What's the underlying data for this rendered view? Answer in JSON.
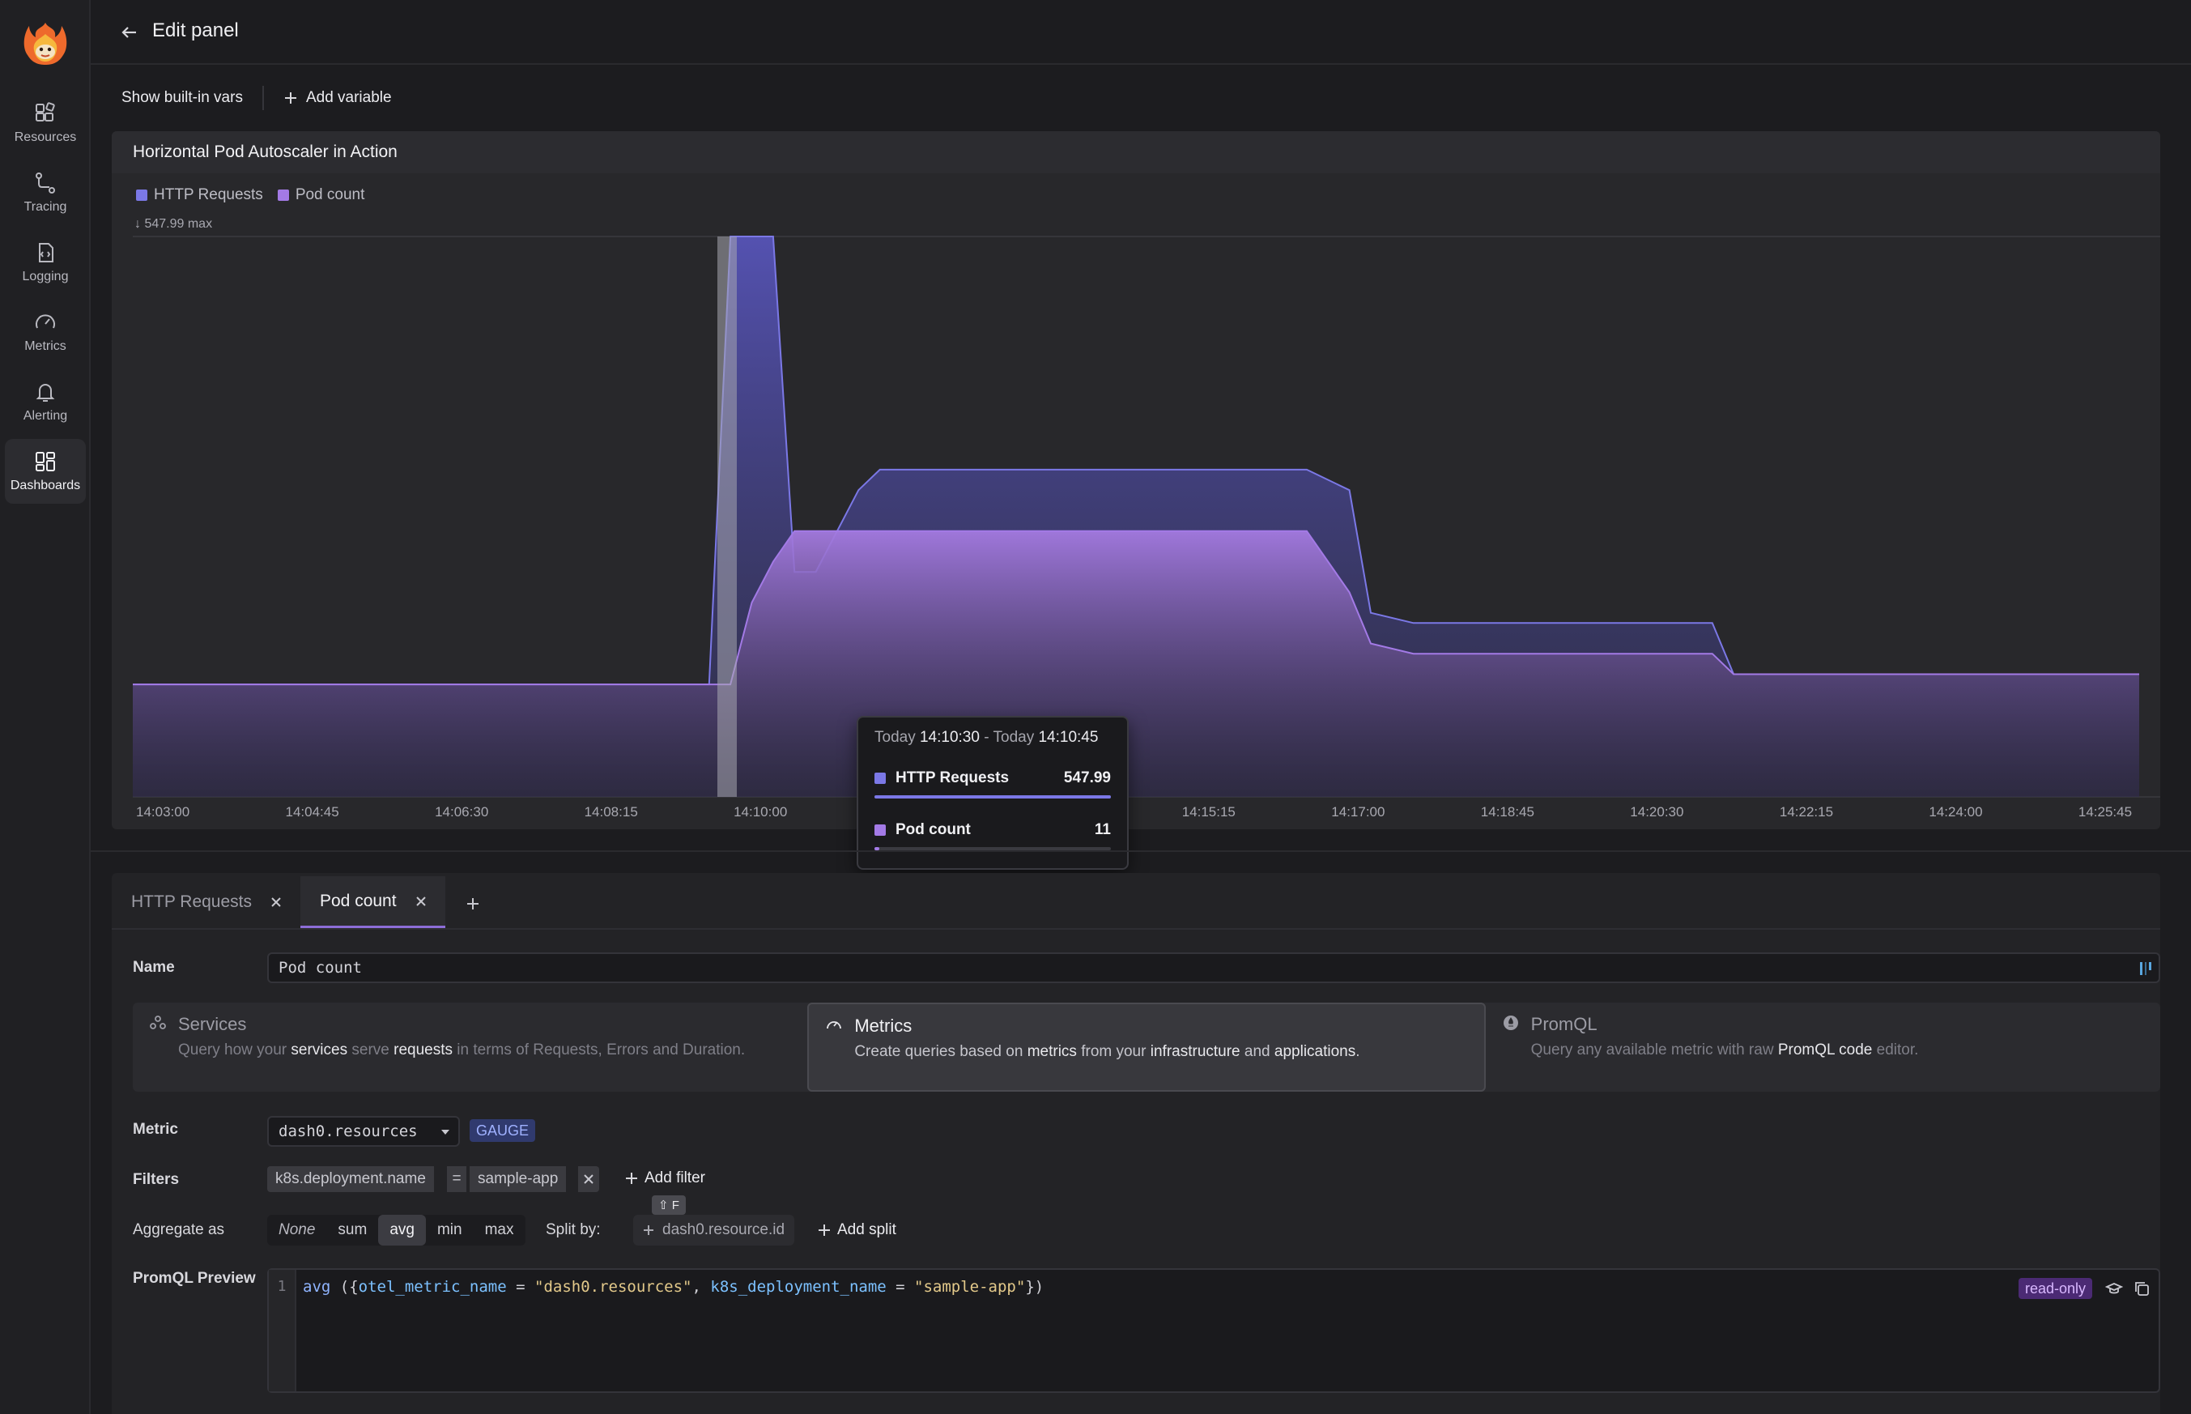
{
  "header": {
    "title": "Edit panel"
  },
  "sidebar": {
    "items": [
      {
        "label": "Resources",
        "icon": "resources-icon"
      },
      {
        "label": "Tracing",
        "icon": "tracing-icon"
      },
      {
        "label": "Logging",
        "icon": "logging-icon"
      },
      {
        "label": "Metrics",
        "icon": "metrics-icon"
      },
      {
        "label": "Alerting",
        "icon": "alerting-icon"
      },
      {
        "label": "Dashboards",
        "icon": "dashboards-icon",
        "active": true
      }
    ]
  },
  "toolbar": {
    "show_vars": "Show built-in vars",
    "add_variable": "Add variable"
  },
  "panel": {
    "title": "Horizontal Pod Autoscaler in Action",
    "ymax_label": "547.99 max"
  },
  "chart_data": {
    "type": "area",
    "title": "Horizontal Pod Autoscaler in Action",
    "x_ticks": [
      "14:03:00",
      "14:04:45",
      "14:06:30",
      "14:08:15",
      "14:10:00",
      "14:11:45",
      "14:13:30",
      "14:15:15",
      "14:17:00",
      "14:18:45",
      "14:20:30",
      "14:22:15",
      "14:24:00",
      "14:25:45"
    ],
    "x": [
      "14:03:00",
      "14:09:45",
      "14:10:00",
      "14:10:15",
      "14:10:30",
      "14:10:45",
      "14:11:00",
      "14:11:30",
      "14:11:45",
      "14:16:45",
      "14:17:15",
      "14:17:30",
      "14:18:00",
      "14:21:30",
      "14:21:45",
      "14:26:30"
    ],
    "ylim": [
      0,
      547.99
    ],
    "series": [
      {
        "name": "HTTP Requests",
        "color": "#7b78e6",
        "values": [
          110,
          110,
          547.99,
          547.99,
          547.99,
          220,
          220,
          300,
          320,
          320,
          300,
          180,
          170,
          170,
          120,
          120
        ]
      },
      {
        "name": "Pod count",
        "color": "#a37ae6",
        "values": [
          110,
          110,
          110,
          190,
          230,
          260,
          260,
          260,
          260,
          260,
          200,
          150,
          140,
          140,
          120,
          120
        ]
      }
    ],
    "legend": "top-left",
    "grid": false
  },
  "tooltip": {
    "from_prefix": "Today",
    "from_time": "14:10:30",
    "dash": "-",
    "to_prefix": "Today",
    "to_time": "14:10:45",
    "rows": [
      {
        "name": "HTTP Requests",
        "value": "547.99",
        "fraction": 1.0,
        "color": "#7b78e6"
      },
      {
        "name": "Pod count",
        "value": "11",
        "fraction": 0.02,
        "color": "#a37ae6"
      }
    ]
  },
  "editor": {
    "tabs": [
      {
        "label": "HTTP Requests",
        "active": false
      },
      {
        "label": "Pod count",
        "active": true
      }
    ],
    "name_label": "Name",
    "name_value": "Pod count",
    "query_types": [
      {
        "title": "Services",
        "desc": [
          "Query how your ",
          "services",
          " serve ",
          "requests",
          " in terms of Requests, Errors and Duration."
        ]
      },
      {
        "title": "Metrics",
        "desc": [
          "Create queries based on ",
          "metrics",
          " from your ",
          "infrastructure",
          " and ",
          "applications",
          "."
        ]
      },
      {
        "title": "PromQL",
        "desc": [
          "Query any available metric with raw ",
          "PromQL code",
          " editor."
        ]
      }
    ],
    "metric_label": "Metric",
    "metric_value": "dash0.resources",
    "metric_type": "GAUGE",
    "filters_label": "Filters",
    "filter": {
      "key": "k8s.deployment.name",
      "op": "=",
      "value": "sample-app"
    },
    "add_filter": "Add filter",
    "shortcut": "⇧ F",
    "aggregate_label": "Aggregate as",
    "aggregate_options": [
      "None",
      "sum",
      "avg",
      "min",
      "max"
    ],
    "aggregate_selected": "avg",
    "split_label": "Split by:",
    "split_placeholder": "dash0.resource.id",
    "add_split": "Add split",
    "preview_label": "PromQL Preview",
    "line_number": "1",
    "code": {
      "fn": "avg",
      "open": " ({",
      "k1": "otel_metric_name",
      "eq1": " = ",
      "v1": "\"dash0.resources\"",
      "comma": ", ",
      "k2": "k8s_deployment_name",
      "eq2": " = ",
      "v2": "\"sample-app\"",
      "close": "})"
    },
    "readonly": "read-only"
  }
}
